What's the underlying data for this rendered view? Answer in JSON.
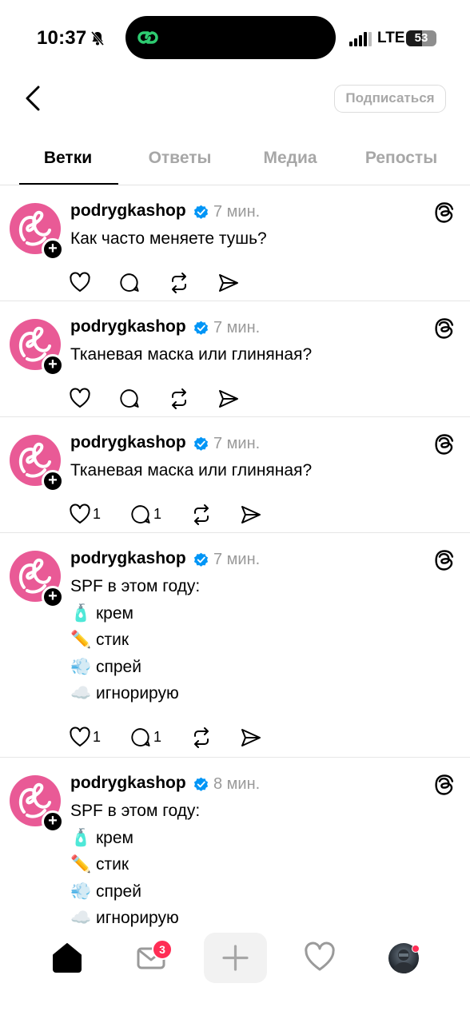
{
  "status": {
    "time": "10:37",
    "network": "LTE",
    "battery": "53",
    "battery_level": 0.53
  },
  "header": {
    "subscribe_label": "Подписаться"
  },
  "tabs": [
    {
      "label": "Ветки",
      "active": true
    },
    {
      "label": "Ответы",
      "active": false
    },
    {
      "label": "Медиа",
      "active": false
    },
    {
      "label": "Репосты",
      "active": false
    }
  ],
  "posts": [
    {
      "username": "podrygkashop",
      "time": "7 мин.",
      "lines": [
        "Как часто меняете тушь?"
      ],
      "likes": "",
      "replies": ""
    },
    {
      "username": "podrygkashop",
      "time": "7 мин.",
      "lines": [
        "Тканевая маска или глиняная?"
      ],
      "likes": "",
      "replies": ""
    },
    {
      "username": "podrygkashop",
      "time": "7 мин.",
      "lines": [
        "Тканевая маска или глиняная?"
      ],
      "likes": "1",
      "replies": "1"
    },
    {
      "username": "podrygkashop",
      "time": "7 мин.",
      "lines": [
        "SPF в этом году:",
        "🧴 крем",
        "✏️ стик",
        "💨 спрей",
        "☁️ игнорирую"
      ],
      "likes": "1",
      "replies": "1"
    },
    {
      "username": "podrygkashop",
      "time": "8 мин.",
      "lines": [
        "SPF в этом году:",
        "🧴 крем",
        "✏️ стик",
        "💨 спрей",
        "☁️ игнорирую"
      ],
      "likes": "",
      "replies": ""
    }
  ],
  "nav": {
    "inbox_badge": "3"
  },
  "colors": {
    "brand_pink": "#e95a96",
    "verified_blue": "#0095f6",
    "badge_red": "#ff2d55"
  }
}
